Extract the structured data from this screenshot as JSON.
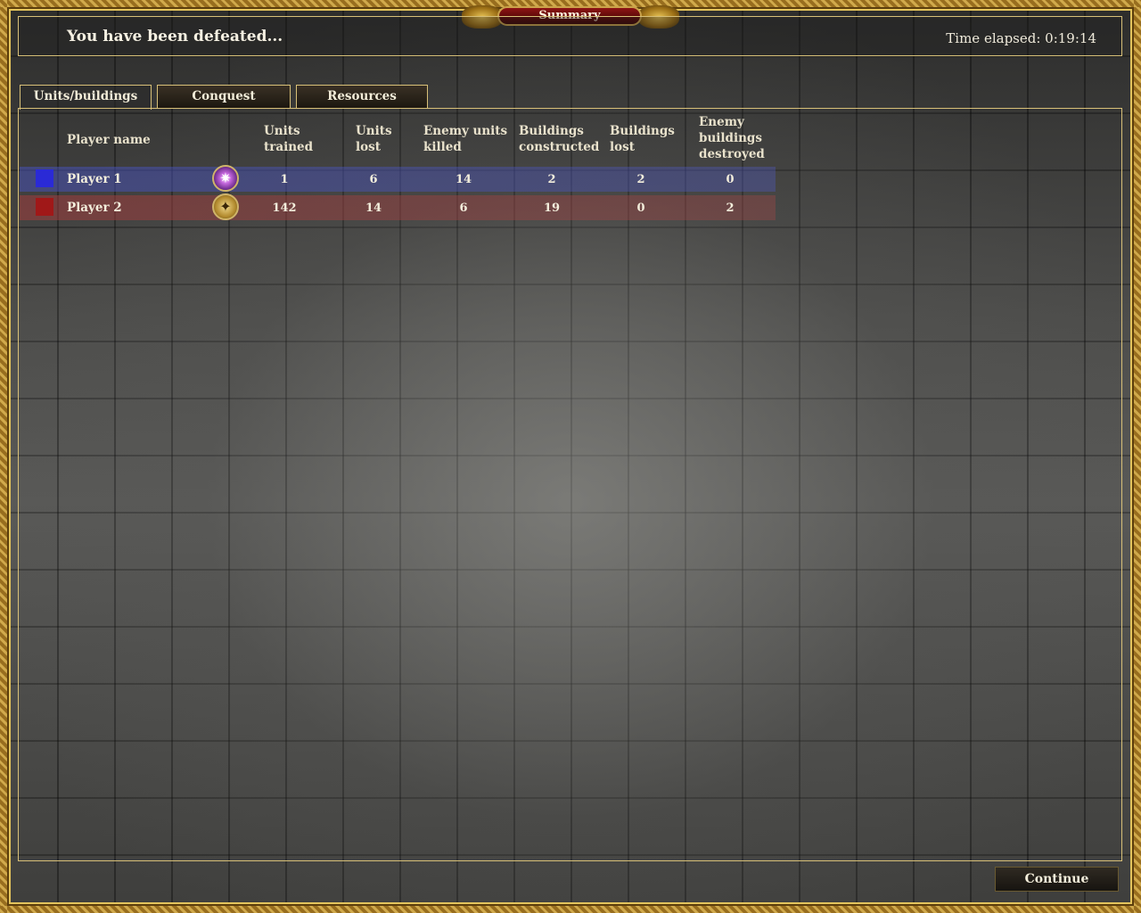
{
  "window": {
    "title": "Summary"
  },
  "header": {
    "status": "You have been defeated...",
    "time_elapsed": "Time elapsed: 0:19:14"
  },
  "tabs": [
    {
      "label": "Units/buildings",
      "active": true
    },
    {
      "label": "Conquest",
      "active": false
    },
    {
      "label": "Resources",
      "active": false
    }
  ],
  "table": {
    "headers": {
      "player_name": "Player name",
      "units_trained_1": "Units",
      "units_trained_2": "trained",
      "units_lost_1": "Units",
      "units_lost_2": "lost",
      "enemy_units_killed_1": "Enemy units",
      "enemy_units_killed_2": "killed",
      "buildings_constructed_1": "Buildings",
      "buildings_constructed_2": "constructed",
      "buildings_lost_1": "Buildings",
      "buildings_lost_2": "lost",
      "enemy_buildings_destroyed_1": "Enemy",
      "enemy_buildings_destroyed_2": "buildings",
      "enemy_buildings_destroyed_3": "destroyed"
    },
    "rows": [
      {
        "name": "Player 1",
        "color": "#2a2ad6",
        "emblem": "purple-star-emblem-icon",
        "units_trained": "1",
        "units_lost": "6",
        "enemy_units_killed": "14",
        "buildings_constructed": "2",
        "buildings_lost": "2",
        "enemy_buildings_destroyed": "0"
      },
      {
        "name": "Player 2",
        "color": "#a01818",
        "emblem": "gold-eagle-emblem-icon",
        "units_trained": "142",
        "units_lost": "14",
        "enemy_units_killed": "6",
        "buildings_constructed": "19",
        "buildings_lost": "0",
        "enemy_buildings_destroyed": "2"
      }
    ]
  },
  "footer": {
    "continue_label": "Continue"
  },
  "colors": {
    "frame_gold": "#b98a2a",
    "title_red": "#8e1414",
    "border_gold": "#d8c078"
  }
}
